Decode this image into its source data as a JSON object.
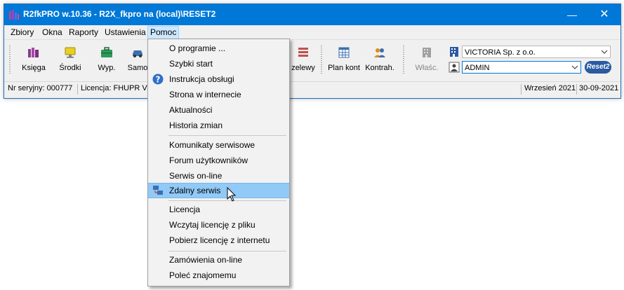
{
  "window": {
    "title": "R2fkPRO w.10.36 - R2X_fkpro na (local)\\RESET2",
    "minimize": "—",
    "close": "✕"
  },
  "menubar": [
    "Zbiory",
    "Okna",
    "Raporty",
    "Ustawienia",
    "Pomoc"
  ],
  "toolbar": {
    "buttons": [
      "Księga",
      "Środki",
      "Wyp.",
      "Samo",
      "zelewy",
      "Plan kont",
      "Kontrah.",
      "Właśc."
    ],
    "company_combo": "VICTORIA Sp. z o.o.",
    "user_combo": "ADMIN",
    "logo": "Reset2"
  },
  "statusbar": {
    "serial": "Nr seryjny: 000777",
    "license": "Licencja: FHUPR VIC",
    "period": "Wrzesień 2021",
    "date": "30-09-2021"
  },
  "help_menu": {
    "group1": [
      "O programie ...",
      "Szybki start",
      "Instrukcja obsługi",
      "Strona w internecie",
      "Aktualności",
      "Historia zmian"
    ],
    "group2": [
      "Komunikaty serwisowe",
      "Forum użytkowników",
      "Serwis on-line",
      "Zdalny serwis"
    ],
    "group3": [
      "Licencja",
      "Wczytaj licencję z pliku",
      "Pobierz licencję z internetu"
    ],
    "group4": [
      "Zamówienia on-line",
      "Poleć znajomemu"
    ]
  },
  "colors": {
    "titlebar": "#0078d7",
    "menu_highlight": "#91c9f7",
    "menubar_active": "#cce8ff"
  }
}
